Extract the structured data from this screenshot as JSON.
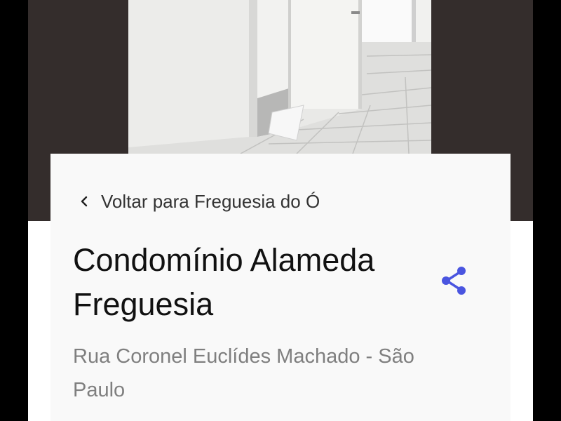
{
  "hero": {
    "image_description_icon": "photo-icon"
  },
  "back_link": {
    "icon": "chevron-left-icon",
    "label": "Voltar para Freguesia do Ó"
  },
  "listing": {
    "title": "Condomínio Alameda Freguesia",
    "address": "Rua Coronel Euclídes Machado - São Paulo"
  },
  "share_button": {
    "icon": "share-icon"
  },
  "colors": {
    "hero_background": "#342d2c",
    "card_background": "#f9f9f9",
    "accent": "#4a55e0",
    "title_text": "#111111",
    "address_text": "#7f7f7f"
  }
}
